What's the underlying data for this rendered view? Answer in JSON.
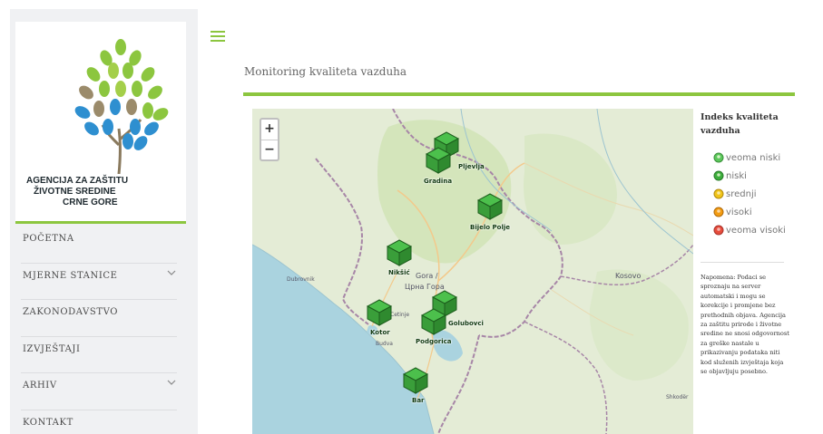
{
  "logo": {
    "line1": "AGENCIJA ZA ZAŠTITU",
    "line2": "ŽIVOTNE SREDINE",
    "line3": "CRNE GORE"
  },
  "nav": {
    "items": [
      {
        "label": "POČETNA"
      },
      {
        "label": "MJERNE STANICE"
      },
      {
        "label": "ZAKONODAVSTVO"
      },
      {
        "label": "IZVJEŠTAJI"
      },
      {
        "label": "ARHIV"
      },
      {
        "label": "KONTAKT"
      }
    ]
  },
  "page": {
    "title": "Monitoring kvaliteta vazduha"
  },
  "map": {
    "zoom_in": "+",
    "zoom_out": "−",
    "stations": [
      {
        "label": "Pljevlja",
        "color": "#4cc04c"
      },
      {
        "label": "Gradina",
        "color": "#4cc04c"
      },
      {
        "label": "Bijelo Polje",
        "color": "#4cc04c"
      },
      {
        "label": "Nikšić",
        "color": "#4cc04c"
      },
      {
        "label": "Kotor",
        "color": "#4cc04c"
      },
      {
        "label": "Golubovci",
        "color": "#4cc04c"
      },
      {
        "label": "Podgorica",
        "color": "#4cc04c"
      },
      {
        "label": "Bar",
        "color": "#4cc04c"
      }
    ],
    "place_labels": {
      "dubrovnik": "Dubrovnik",
      "gora": "Gora /",
      "cyrillic": "Црна Гора",
      "cetinje": "Cetinje",
      "budva": "Budva",
      "kosovo": "Kosovo",
      "shkoder": "Shkodër"
    }
  },
  "legend": {
    "title": "Indeks kvaliteta vazduha",
    "items": [
      {
        "label": "veoma niski",
        "color": "#5cc85c"
      },
      {
        "label": "niski",
        "color": "#3cae3c"
      },
      {
        "label": "srednji",
        "color": "#f0c419"
      },
      {
        "label": "visoki",
        "color": "#f39c12"
      },
      {
        "label": "veoma visoki",
        "color": "#e74c3c"
      }
    ]
  },
  "note": {
    "text": "Napomena: Podaci se sproznaju na server automatski i mogu se korekcije i promjene bez prethodnih objava. Agencija za zaštitu prirode i životne sredine ne snosi odgovornost za greške nastale u prikazivanju podataka niti kod služenih izvještaja koja se objavljuju posebno."
  }
}
